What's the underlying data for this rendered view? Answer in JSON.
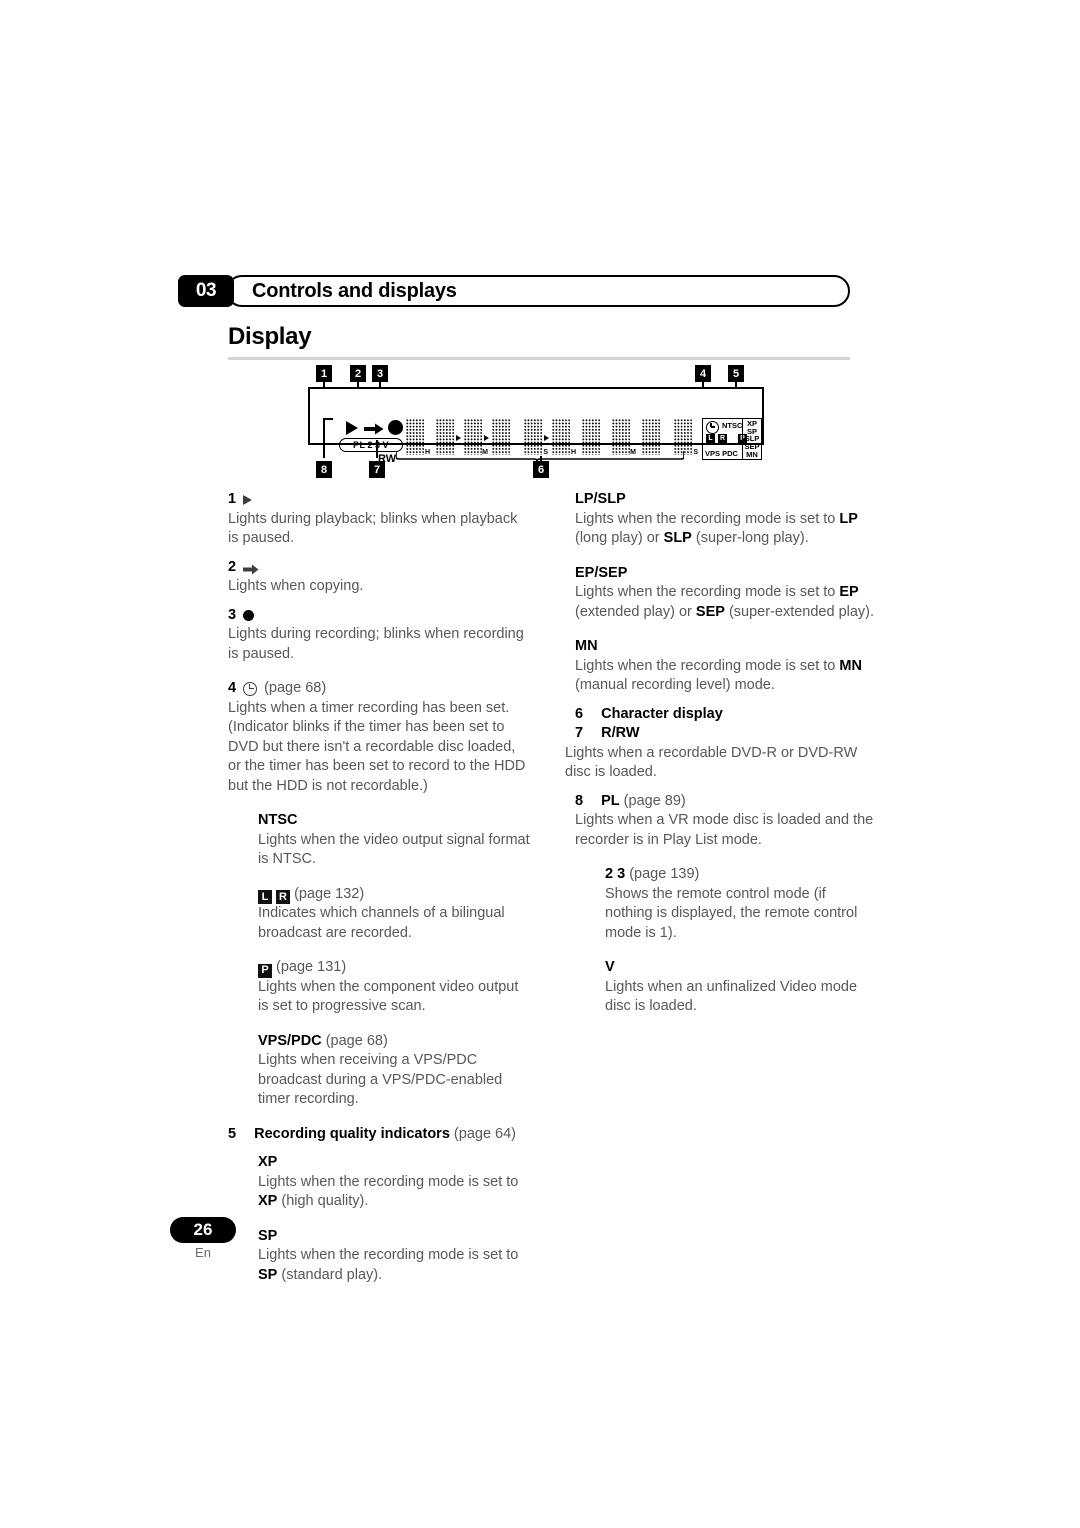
{
  "header": {
    "chapter_number": "03",
    "chapter_title": "Controls and displays",
    "section_title": "Display"
  },
  "figure": {
    "callouts": [
      "1",
      "2",
      "3",
      "4",
      "5",
      "6",
      "7",
      "8"
    ],
    "lcd": {
      "play_icon": "play-triangle-icon",
      "copy_icon": "right-arrow-icon",
      "record_icon": "record-dot-icon",
      "pl_label": "PL",
      "mode_2": "2",
      "mode_3": "3",
      "mode_v": "V",
      "rw_label": "RW",
      "unit_labels": [
        "H",
        "M",
        "S",
        "H",
        "M",
        "S"
      ],
      "indicators": {
        "timer_icon": "clock-icon",
        "ntsc": "NTSC",
        "left_channel": "L",
        "right_channel": "R",
        "progressive": "P",
        "vps": "VPS",
        "pdc": "PDC",
        "quality": [
          "XP",
          "SP",
          "SLP",
          "SEP",
          "MN"
        ]
      }
    }
  },
  "left_column": [
    {
      "num": "1",
      "icon": "play-triangle-icon",
      "body": "Lights during playback; blinks when playback is paused."
    },
    {
      "num": "2",
      "icon": "right-arrow-icon",
      "body": "Lights when copying."
    },
    {
      "num": "3",
      "icon": "record-dot-icon",
      "body": "Lights during recording; blinks when recording is paused."
    },
    {
      "num": "4",
      "icon": "clock-icon",
      "page_ref": "(page 68)",
      "body": "Lights when a timer recording has been set. (Indicator blinks if the timer has been set to DVD but there isn't a recordable disc loaded, or the timer has been set to record to the HDD but the HDD is not recordable.)"
    }
  ],
  "left_subitems": [
    {
      "heading": "NTSC",
      "body": "Lights when the video output signal format is NTSC."
    },
    {
      "glyphs": [
        "L",
        "R"
      ],
      "page_ref": "(page 132)",
      "body": "Indicates which channels of a bilingual broadcast are recorded."
    },
    {
      "glyphs": [
        "P"
      ],
      "page_ref": "(page 131)",
      "body": "Lights when the component video output is set to progressive scan."
    },
    {
      "heading": "VPS/PDC",
      "page_ref": "(page 68)",
      "body": "Lights when receiving a VPS/PDC broadcast during a VPS/PDC-enabled timer recording."
    }
  ],
  "item5": {
    "num": "5",
    "heading": "Recording quality indicators",
    "page_ref": "(page 64)",
    "subitems": [
      {
        "heading": "XP",
        "body_pre": "Lights when the recording mode is set to ",
        "body_bold": "XP",
        "body_post": " (high quality)."
      },
      {
        "heading": "SP",
        "body_pre": "Lights when the recording mode is set to ",
        "body_bold": "SP",
        "body_post": " (standard play)."
      }
    ]
  },
  "right_column": {
    "quality_continued": [
      {
        "heading": "LP/SLP",
        "body_pre": "Lights when the recording mode is set to ",
        "body_bold1": "LP",
        "body_mid": " (long play) or ",
        "body_bold2": "SLP",
        "body_post": " (super-long play)."
      },
      {
        "heading": "EP/SEP",
        "body_pre": "Lights when the recording mode is set to ",
        "body_bold1": "EP",
        "body_mid": " (extended play) or ",
        "body_bold2": "SEP",
        "body_post": " (super-extended play)."
      },
      {
        "heading": "MN",
        "body_pre": "Lights when the recording mode is set to ",
        "body_bold1": "MN",
        "body_post": " (manual recording level) mode."
      }
    ],
    "item6": {
      "num": "6",
      "heading": "Character display"
    },
    "item7": {
      "num": "7",
      "heading": "R/RW",
      "body": "Lights when a recordable DVD-R or DVD-RW disc is loaded."
    },
    "item8": {
      "num": "8",
      "heading": "PL",
      "page_ref": "(page 89)",
      "body": "Lights when a VR mode disc is loaded and the recorder is in Play List mode."
    },
    "subitems": [
      {
        "heading": "2 3",
        "page_ref": "(page 139)",
        "body": "Shows the remote control mode (if nothing is displayed, the remote control mode is 1)."
      },
      {
        "heading": "V",
        "body": "Lights when an unfinalized Video mode disc is loaded."
      }
    ]
  },
  "footer": {
    "page_number": "26",
    "language": "En"
  }
}
